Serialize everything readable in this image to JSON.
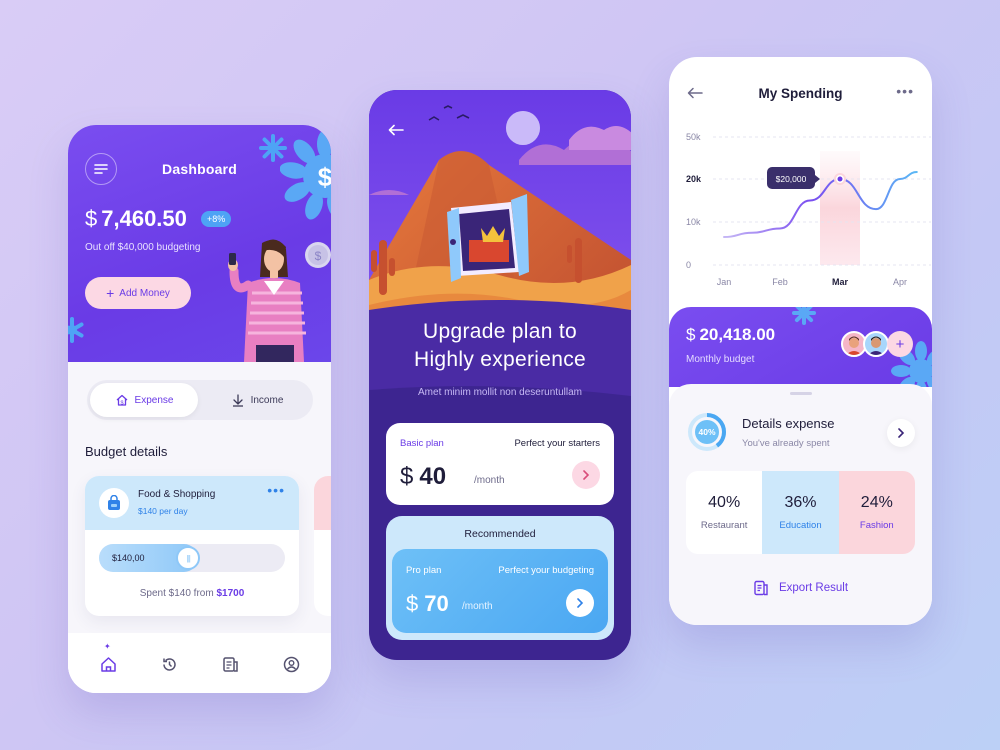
{
  "colors": {
    "primary": "#6a3be6",
    "light_blue": "#cde8fb",
    "pink": "#fcd8e4",
    "accent_blue": "#4aa7f2"
  },
  "dashboard": {
    "title": "Dashboard",
    "currency": "$",
    "balance": "7,460.50",
    "growth_badge": "+8%",
    "budget_note": "Out off $40,000 budgeting",
    "add_money_label": "Add Money",
    "toggle": {
      "expense_label": "Expense",
      "income_label": "Income",
      "selected": "Expense"
    },
    "section_title": "Budget details",
    "card": {
      "category": "Food & Shopping",
      "rate": "$140 per day",
      "slider_value": "$140,00",
      "slider_fill_fraction": 0.48,
      "spent_prefix": "Spent $140 from",
      "spent_total": "$1700"
    },
    "nav": {
      "items": [
        "home-icon",
        "history-icon",
        "report-icon",
        "profile-icon"
      ],
      "active": "home-icon"
    }
  },
  "upgrade": {
    "headline_line1": "Upgrade plan to",
    "headline_line2": "Highly experience",
    "subtitle": "Amet minim mollit non deseruntullam",
    "basic": {
      "plan_label": "Basic plan",
      "description": "Perfect your starters",
      "currency": "$",
      "price": "40",
      "period": "/month"
    },
    "recommended_label": "Recommended",
    "pro": {
      "plan_label": "Pro plan",
      "description": "Perfect your budgeting",
      "currency": "$",
      "price": "70",
      "period": "/month"
    }
  },
  "spending": {
    "title": "My Spending",
    "tooltip": "$20,000",
    "budget_currency": "$",
    "budget_amount": "20,418.00",
    "budget_label": "Monthly budget",
    "details": {
      "ring_label": "40%",
      "ring_fraction": 0.4,
      "title": "Details expense",
      "subtitle": "You've already spent"
    },
    "stats": [
      {
        "pct": "40%",
        "category": "Restaurant",
        "bg": "#ffffff",
        "label_color": "#6d6a8a"
      },
      {
        "pct": "36%",
        "category": "Education",
        "bg": "#cde8fb",
        "label_color": "#2f82e8"
      },
      {
        "pct": "24%",
        "category": "Fashion",
        "bg": "#fbd6dc",
        "label_color": "#6a3be6"
      }
    ],
    "export_label": "Export Result"
  },
  "chart_data": {
    "type": "line",
    "title": "",
    "xlabel": "",
    "ylabel": "",
    "categories": [
      "Jan",
      "Feb",
      "Mar",
      "Apr"
    ],
    "highlight_category": "Mar",
    "y_ticks": [
      "50k",
      "20k",
      "10k",
      "0"
    ],
    "series": [
      {
        "x": [
          0,
          0.5,
          1,
          1.5,
          2,
          2.6,
          3,
          3.3
        ],
        "values": [
          6.5,
          7.5,
          8.5,
          15,
          20,
          13,
          20,
          25
        ]
      }
    ]
  }
}
